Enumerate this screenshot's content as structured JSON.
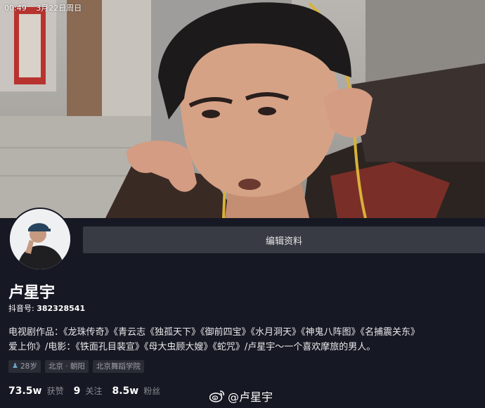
{
  "status_bar": {
    "time": "00:49",
    "date": "3月22日周日"
  },
  "profile": {
    "edit_button_label": "编辑资料",
    "name": "卢星宇",
    "douyin_id_label": "抖音号:",
    "douyin_id_value": "382328541",
    "bio_line1": "电视剧作品：《龙珠传奇》《青云志《独孤天下》《御前四宝》《水月洞天》《神鬼八阵图》《名捕震关东》",
    "bio_line2": "爱上你》/电影：《铁面孔目裴宣》《母大虫顾大嫂》《蛇咒》/卢星宇～一个喜欢摩旅的男人。",
    "tags": [
      {
        "icon": "person-icon",
        "text": "28岁"
      },
      {
        "text": "北京 · 朝阳"
      },
      {
        "text": "北京舞蹈学院"
      }
    ],
    "stats": [
      {
        "num": "73.5w",
        "label": "获赞"
      },
      {
        "num": "9",
        "label": "关注"
      },
      {
        "num": "8.5w",
        "label": "粉丝"
      }
    ]
  },
  "watermark": {
    "icon": "weibo-icon",
    "text": "@卢星宇"
  }
}
